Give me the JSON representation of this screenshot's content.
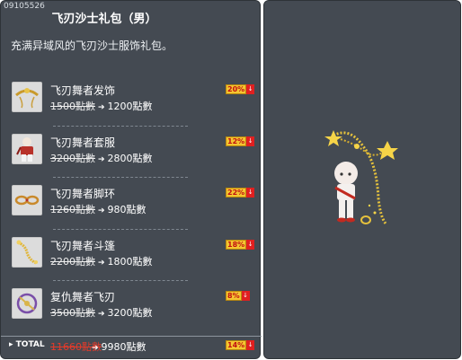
{
  "code": "09105526",
  "title": "飞刃沙士礼包（男）",
  "description": "充满异域风的飞刃沙士服饰礼包。",
  "items": [
    {
      "name": "飞刃舞者发饰",
      "old_price": "1500點數",
      "new_price": "1200點數",
      "discount": "20%",
      "icon": "headband-icon"
    },
    {
      "name": "飞刃舞者套服",
      "old_price": "3200點數",
      "new_price": "2800點數",
      "discount": "12%",
      "icon": "outfit-icon"
    },
    {
      "name": "飞刃舞者脚环",
      "old_price": "1260點數",
      "new_price": "980點數",
      "discount": "22%",
      "icon": "anklet-icon"
    },
    {
      "name": "飞刃舞者斗篷",
      "old_price": "2200點數",
      "new_price": "1800點數",
      "discount": "18%",
      "icon": "cape-icon"
    },
    {
      "name": "复仇舞者飞刃",
      "old_price": "3500點數",
      "new_price": "3200點數",
      "discount": "8%",
      "icon": "blade-icon"
    }
  ],
  "total": {
    "label": "TOTAL",
    "old_price": "11660點數",
    "new_price": "9980點數",
    "discount": "14%"
  },
  "arrow_glyph": "➔",
  "down_glyph": "↓",
  "colors": {
    "panel": "#444a52",
    "badge": "#f4c531",
    "down": "#e02020",
    "total_old": "#e43a2a"
  }
}
